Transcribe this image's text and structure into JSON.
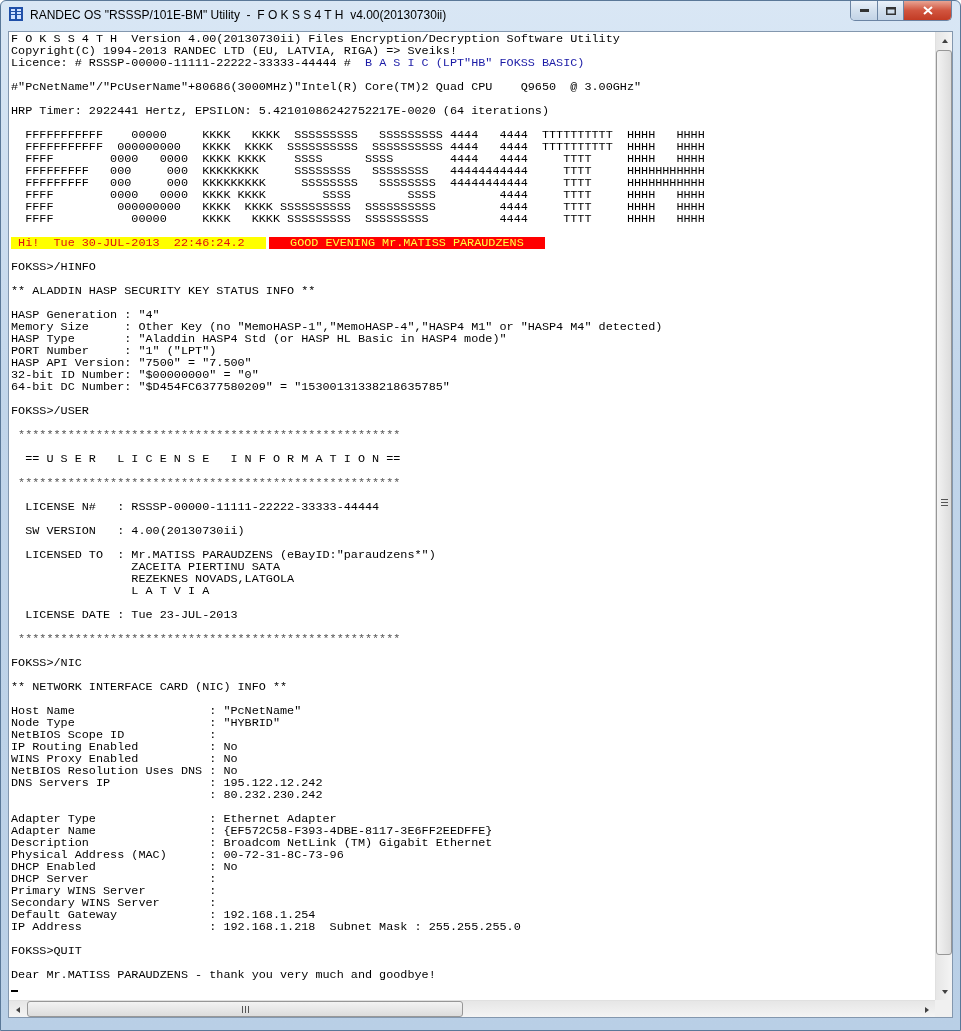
{
  "window": {
    "title": "RANDEC OS \"RSSSP/101E-BM\" Utility  -  F O K S S 4 T H  v4.00(20130730ii)"
  },
  "console": {
    "lines": [
      {
        "kind": "text",
        "text": "F O K S S 4 T H  Version 4.00(20130730ii) Files Encryption/Decryption Software Utility"
      },
      {
        "kind": "text",
        "text": "Copyright(C) 1994-2013 RANDEC LTD (EU, LATVIA, RIGA) => Sveiks!"
      },
      {
        "kind": "segments",
        "segments": [
          {
            "kind": "plain",
            "text": "Licence: # RSSSP-00000-11111-22222-33333-44444 #"
          },
          {
            "kind": "accent",
            "text": "B A S I C (LPT\"HB\" FOKSS BASIC)"
          }
        ]
      },
      {
        "kind": "blank"
      },
      {
        "kind": "text",
        "text": "#\"PcNetName\"/\"PcUserName\"+80686(3000MHz)\"Intel(R) Core(TM)2 Quad CPU    Q9650  @ 3.00GHz\""
      },
      {
        "kind": "blank"
      },
      {
        "kind": "text",
        "text": "HRP Timer: 2922441 Hertz, EPSILON: 5.42101086242752217E-0020 (64 iterations)"
      },
      {
        "kind": "blank"
      },
      {
        "kind": "art",
        "text": "  FFFFFFFFFFF    00000     KKKK   KKKK  SSSSSSSSS   SSSSSSSSS 4444   4444  TTTTTTTTTT  HHHH   HHHH"
      },
      {
        "kind": "art",
        "text": "  FFFFFFFFFFF  000000000   KKKK  KKKK  SSSSSSSSSS  SSSSSSSSSS 4444   4444  TTTTTTTTTT  HHHH   HHHH"
      },
      {
        "kind": "art",
        "text": "  FFFF        0000   0000  KKKK KKKK    SSSS      SSSS        4444   4444     TTTT     HHHH   HHHH"
      },
      {
        "kind": "art",
        "text": "  FFFFFFFFF   000     000  KKKKKKKK     SSSSSSSS   SSSSSSSS   44444444444     TTTT     HHHHHHHHHHH"
      },
      {
        "kind": "art",
        "text": "  FFFFFFFFF   000     000  KKKKKKKKK     SSSSSSSS   SSSSSSSS  44444444444     TTTT     HHHHHHHHHHH"
      },
      {
        "kind": "art",
        "text": "  FFFF        0000   0000  KKKK KKKK        SSSS        SSSS         4444     TTTT     HHHH   HHHH"
      },
      {
        "kind": "art",
        "text": "  FFFF         000000000   KKKK  KKKK SSSSSSSSSS  SSSSSSSSSS         4444     TTTT     HHHH   HHHH"
      },
      {
        "kind": "art",
        "text": "  FFFF           00000     KKKK   KKKK SSSSSSSSS  SSSSSSSSS          4444     TTTT     HHHH   HHHH"
      },
      {
        "kind": "blank"
      },
      {
        "kind": "segments",
        "segments": [
          {
            "kind": "date",
            "text": "Hi!  Tue 30-JUL-2013  22:46:24.2"
          },
          {
            "kind": "message",
            "text": "GOOD EVENING Mr.MATISS PARAUDZENS"
          }
        ]
      },
      {
        "kind": "blank"
      },
      {
        "kind": "text",
        "text": "FOKSS>/HINFO"
      },
      {
        "kind": "blank"
      },
      {
        "kind": "text",
        "text": "** ALADDIN HASP SECURITY KEY STATUS INFO **"
      },
      {
        "kind": "blank"
      },
      {
        "kind": "text",
        "text": "HASP Generation : \"4\""
      },
      {
        "kind": "text",
        "text": "Memory Size     : Other Key (no \"MemoHASP-1\",\"MemoHASP-4\",\"HASP4 M1\" or \"HASP4 M4\" detected)"
      },
      {
        "kind": "text",
        "text": "HASP Type       : \"Aladdin HASP4 Std (or HASP HL Basic in HASP4 mode)\""
      },
      {
        "kind": "text",
        "text": "PORT Number     : \"1\" (\"LPT\")"
      },
      {
        "kind": "text",
        "text": "HASP API Version: \"7500\" = \"7.500\""
      },
      {
        "kind": "text",
        "text": "32-bit ID Number: \"$00000000\" = \"0\""
      },
      {
        "kind": "text",
        "text": "64-bit DC Number: \"$D454FC6377580209\" = \"15300131338218635785\""
      },
      {
        "kind": "blank"
      },
      {
        "kind": "text",
        "text": "FOKSS>/USER"
      },
      {
        "kind": "blank"
      },
      {
        "kind": "rule",
        "text": " ******************************************************"
      },
      {
        "kind": "blank"
      },
      {
        "kind": "text",
        "text": "  == U S E R   L I C E N S E   I N F O R M A T I O N =="
      },
      {
        "kind": "blank"
      },
      {
        "kind": "rule",
        "text": " ******************************************************"
      },
      {
        "kind": "blank"
      },
      {
        "kind": "text",
        "text": "  LICENSE N#   : RSSSP-00000-11111-22222-33333-44444"
      },
      {
        "kind": "blank"
      },
      {
        "kind": "text",
        "text": "  SW VERSION   : 4.00(20130730ii)"
      },
      {
        "kind": "blank"
      },
      {
        "kind": "text",
        "text": "  LICENSED TO  : Mr.MATISS PARAUDZENS (eBayID:\"paraudzens*\")"
      },
      {
        "kind": "text",
        "text": "                 ZACEITA PIERTINU SATA"
      },
      {
        "kind": "text",
        "text": "                 REZEKNES NOVADS,LATGOLA"
      },
      {
        "kind": "text",
        "text": "                 L A T V I A"
      },
      {
        "kind": "blank"
      },
      {
        "kind": "text",
        "text": "  LICENSE DATE : Tue 23-JUL-2013"
      },
      {
        "kind": "blank"
      },
      {
        "kind": "rule",
        "text": " ******************************************************"
      },
      {
        "kind": "blank"
      },
      {
        "kind": "text",
        "text": "FOKSS>/NIC"
      },
      {
        "kind": "blank"
      },
      {
        "kind": "text",
        "text": "** NETWORK INTERFACE CARD (NIC) INFO **"
      },
      {
        "kind": "blank"
      },
      {
        "kind": "text",
        "text": "Host Name                   : \"PcNetName\""
      },
      {
        "kind": "text",
        "text": "Node Type                   : \"HYBRID\""
      },
      {
        "kind": "text",
        "text": "NetBIOS Scope ID            :"
      },
      {
        "kind": "text",
        "text": "IP Routing Enabled          : No"
      },
      {
        "kind": "text",
        "text": "WINS Proxy Enabled          : No"
      },
      {
        "kind": "text",
        "text": "NetBIOS Resolution Uses DNS : No"
      },
      {
        "kind": "text",
        "text": "DNS Servers IP              : 195.122.12.242"
      },
      {
        "kind": "text",
        "text": "                            : 80.232.230.242"
      },
      {
        "kind": "blank"
      },
      {
        "kind": "text",
        "text": "Adapter Type                : Ethernet Adapter"
      },
      {
        "kind": "text",
        "text": "Adapter Name                : {EF572C58-F393-4DBE-8117-3E6FF2EEDFFE}"
      },
      {
        "kind": "text",
        "text": "Description                 : Broadcom NetLink (TM) Gigabit Ethernet"
      },
      {
        "kind": "text",
        "text": "Physical Address (MAC)      : 00-72-31-8C-73-96"
      },
      {
        "kind": "text",
        "text": "DHCP Enabled                : No"
      },
      {
        "kind": "text",
        "text": "DHCP Server                 :"
      },
      {
        "kind": "text",
        "text": "Primary WINS Server         :"
      },
      {
        "kind": "text",
        "text": "Secondary WINS Server       :"
      },
      {
        "kind": "text",
        "text": "Default Gateway             : 192.168.1.254"
      },
      {
        "kind": "text",
        "text": "IP Address                  : 192.168.1.218  Subnet Mask : 255.255.255.0"
      },
      {
        "kind": "blank"
      },
      {
        "kind": "text",
        "text": "FOKSS>QUIT"
      },
      {
        "kind": "blank"
      },
      {
        "kind": "text",
        "text": "Dear Mr.MATISS PARAUDZENS - thank you very much and goodbye!"
      },
      {
        "kind": "cursor"
      }
    ]
  }
}
